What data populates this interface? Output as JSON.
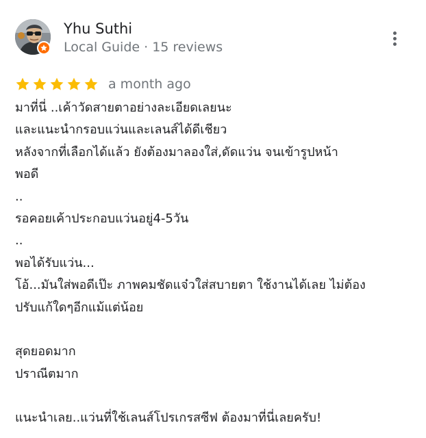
{
  "reviewer": {
    "name": "Yhu Suthi",
    "meta": "Local Guide · 15 reviews",
    "avatar_icon": "user-photo-avatar",
    "badge_icon": "local-guide-star-badge",
    "badge_color": "#ff6d00"
  },
  "menu": {
    "icon": "more-vert-icon"
  },
  "rating": {
    "stars": 5,
    "max": 5,
    "star_color": "#fbbc04",
    "date": "a month ago"
  },
  "review": {
    "lines": [
      "มาที่นี่ ..เค้าวัดสายตาอย่างละเอียดเลยนะ",
      "และแนะนำกรอบแว่นและเลนส์ได้ดีเชียว",
      "หลังจากที่เลือกได้แล้ว ยังต้องมาลองใส่,ดัดแว่น จนเข้ารูปหน้า",
      "พอดี",
      "..",
      "รอคอยเค้าประกอบแว่นอยู่4-5วัน",
      "..",
      "พอได้รับแว่น...",
      "โอ้...มันใส่พอดีเป๊ะ ภาพคมชัดแจ๋วใส่สบายตา ใช้งานได้เลย ไม่ต้อง",
      "ปรับแก้ใดๆอีกแม้แต่น้อย",
      "",
      "สุดยอดมาก",
      "ปราณีตมาก",
      "",
      "แนะนำเลย..แว่นที่ใช้เลนส์โปรเกรสซีฟ ต้องมาที่นี่เลยครับ!"
    ]
  }
}
